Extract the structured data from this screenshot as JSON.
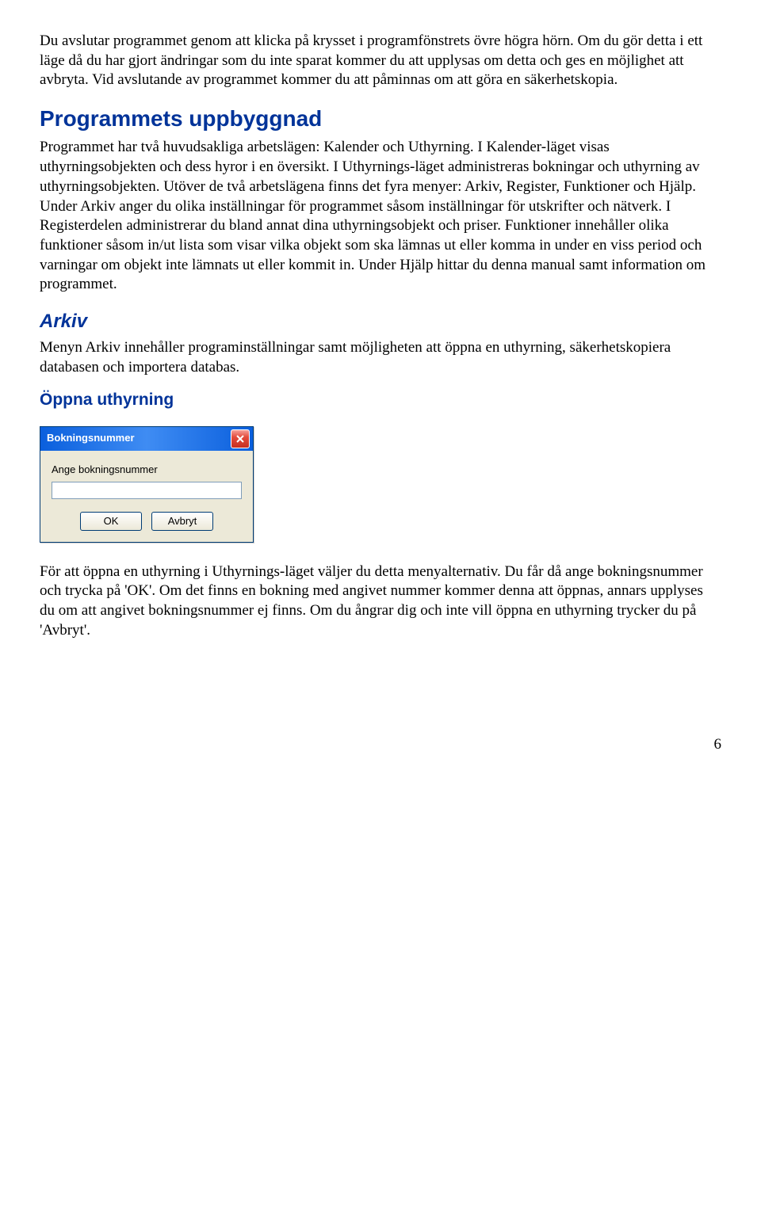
{
  "paragraphs": {
    "p1": "Du avslutar programmet genom att klicka på krysset i programfönstrets övre högra hörn. Om du gör detta i ett läge då du har gjort ändringar som du inte sparat kommer du att upplysas om detta och ges en möjlighet att avbryta. Vid avslutande av programmet kommer du att påminnas om att göra en säkerhetskopia."
  },
  "headings": {
    "uppbyggnad": "Programmets uppbyggnad",
    "arkiv": "Arkiv",
    "oppna": "Öppna uthyrning"
  },
  "programmets": "Programmet har två huvudsakliga arbetslägen: Kalender och Uthyrning. I Kalender-läget visas uthyrningsobjekten och dess hyror i en översikt. I Uthyrnings-läget administreras bokningar och uthyrning av uthyrningsobjekten.\nUtöver de två arbetslägena finns det fyra menyer: Arkiv, Register, Funktioner och Hjälp. Under Arkiv anger du olika inställningar för programmet såsom inställningar för utskrifter och nätverk. I Registerdelen administrerar du bland annat dina uthyrningsobjekt och priser. Funktioner innehåller olika funktioner såsom in/ut lista som visar vilka objekt som ska lämnas ut eller komma in under en viss period och varningar om objekt inte lämnats ut eller kommit in. Under Hjälp hittar du denna manual samt information om programmet.",
  "arkiv_para": "Menyn Arkiv innehåller programinställningar samt möjligheten att öppna en uthyrning, säkerhetskopiera databasen och importera databas.",
  "dialog": {
    "title": "Bokningsnummer",
    "label": "Ange bokningsnummer",
    "close_aria": "Close",
    "ok": "OK",
    "cancel": "Avbryt",
    "input_value": ""
  },
  "after_dialog": "För att öppna en uthyrning i Uthyrnings-läget väljer du detta menyalternativ. Du får då ange bokningsnummer och trycka på 'OK'. Om det finns en bokning med angivet nummer kommer denna att öppnas, annars upplyses du om att angivet bokningsnummer ej finns. Om du ångrar dig och inte vill öppna en uthyrning trycker du på 'Avbryt'.",
  "page_number": "6"
}
